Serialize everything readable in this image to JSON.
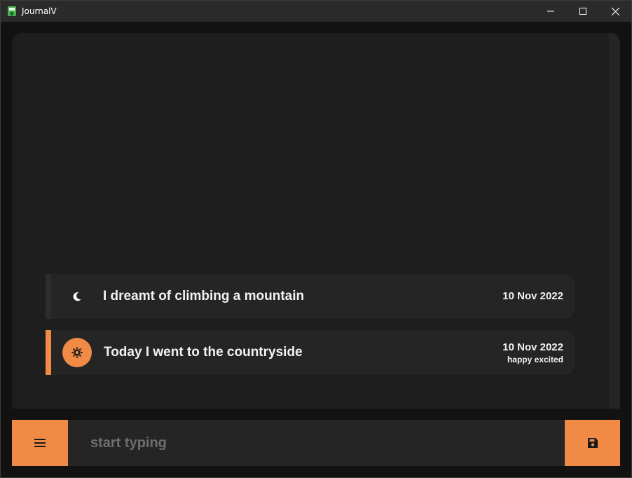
{
  "window": {
    "title": "JournalV",
    "icon": "journal-app-icon"
  },
  "window_controls": {
    "minimize_icon": "minimize-icon",
    "maximize_icon": "maximize-icon",
    "close_icon": "close-icon"
  },
  "entries": [
    {
      "icon": "moon-icon",
      "title": "I dreamt of climbing a mountain",
      "date": "10 Nov 2022",
      "tags": "",
      "selected": false
    },
    {
      "icon": "sun-icon",
      "title": "Today I went to the countryside",
      "date": "10 Nov 2022",
      "tags": "happy excited",
      "selected": true
    }
  ],
  "composer": {
    "placeholder": "start typing",
    "value": "",
    "menu_icon": "hamburger-menu-icon",
    "save_icon": "floppy-disk-icon"
  },
  "colors": {
    "accent": "#f08a45",
    "background": "#121212",
    "panel": "#1e1e1e",
    "card": "#252525",
    "text": "#f2f2f2",
    "placeholder": "#6e6e6e"
  }
}
